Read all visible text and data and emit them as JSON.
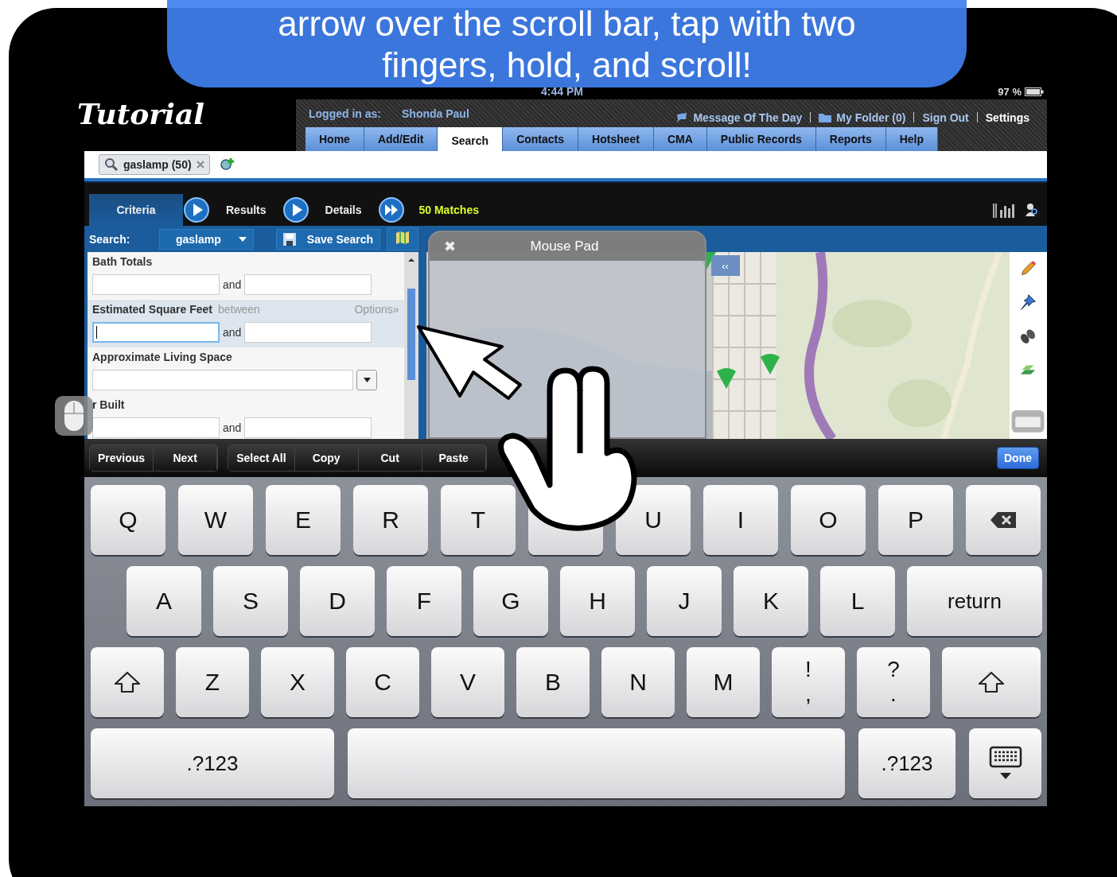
{
  "banner": {
    "lines": [
      "arrow over the scroll bar, tap with two",
      "fingers, hold, and scroll!"
    ]
  },
  "logo": "Tutorial",
  "status_bar": {
    "time": "4:44 PM",
    "battery": "97 %"
  },
  "header": {
    "logged_in_label": "Logged in as:",
    "user": "Shonda Paul",
    "links": [
      {
        "label": "Message Of The Day",
        "kind": "message"
      },
      {
        "label": "My Folder (0)",
        "kind": "folder"
      },
      {
        "label": "Sign Out",
        "kind": "plain"
      },
      {
        "label": "Settings",
        "kind": "plain"
      }
    ],
    "tabs": [
      {
        "label": "Home",
        "selected": false
      },
      {
        "label": "Add/Edit",
        "selected": false
      },
      {
        "label": "Search",
        "selected": true
      },
      {
        "label": "Contacts",
        "selected": false
      },
      {
        "label": "Hotsheet",
        "selected": false
      },
      {
        "label": "CMA",
        "selected": false
      },
      {
        "label": "Public Records",
        "selected": false
      },
      {
        "label": "Reports",
        "selected": false
      },
      {
        "label": "Help",
        "selected": false
      }
    ]
  },
  "search_tab": {
    "label": "gaslamp (50)"
  },
  "nav": {
    "steps": [
      {
        "label": "Criteria",
        "selected": true,
        "kind": "play"
      },
      {
        "label": "Results",
        "selected": false,
        "kind": "play"
      },
      {
        "label": "Details",
        "selected": false,
        "kind": "forward"
      }
    ],
    "matches": "50 Matches"
  },
  "search_bar": {
    "label": "Search:",
    "value": "gaslamp",
    "save": "Save Search"
  },
  "criteria": [
    {
      "label": "Bath Totals",
      "kind": "range",
      "highlighted": false,
      "and": "and"
    },
    {
      "label": "Estimated Square Feet",
      "hint": "between",
      "options": "Options»",
      "kind": "range",
      "highlighted": true,
      "focused": true,
      "and": "and"
    },
    {
      "label": "Approximate Living Space",
      "kind": "select",
      "highlighted": false
    },
    {
      "label": "r Built",
      "kind": "range",
      "highlighted": false,
      "and": "and"
    }
  ],
  "mouse_pad": {
    "title": "Mouse Pad",
    "close": "✖"
  },
  "map": {
    "collapse": "‹‹"
  },
  "toolbar": {
    "groups": [
      [
        "Previous",
        "Next"
      ],
      [
        "Select All",
        "Copy",
        "Cut",
        "Paste"
      ]
    ],
    "done": "Done"
  },
  "keyboard": [
    [
      {
        "kind": "letter",
        "label": "Q"
      },
      {
        "kind": "letter",
        "label": "W"
      },
      {
        "kind": "letter",
        "label": "E"
      },
      {
        "kind": "letter",
        "label": "R"
      },
      {
        "kind": "letter",
        "label": "T"
      },
      {
        "kind": "covered"
      },
      {
        "kind": "letter",
        "label": "U"
      },
      {
        "kind": "letter",
        "label": "I"
      },
      {
        "kind": "letter",
        "label": "O"
      },
      {
        "kind": "letter",
        "label": "P"
      },
      {
        "kind": "backspace"
      }
    ],
    [
      {
        "kind": "letter",
        "label": "A"
      },
      {
        "kind": "letter",
        "label": "S"
      },
      {
        "kind": "letter",
        "label": "D"
      },
      {
        "kind": "letter",
        "label": "F"
      },
      {
        "kind": "letter",
        "label": "G"
      },
      {
        "kind": "letter",
        "label": "H"
      },
      {
        "kind": "letter",
        "label": "J"
      },
      {
        "kind": "letter",
        "label": "K"
      },
      {
        "kind": "letter",
        "label": "L"
      },
      {
        "kind": "word",
        "label": "return"
      }
    ],
    [
      {
        "kind": "shift"
      },
      {
        "kind": "letter",
        "label": "Z"
      },
      {
        "kind": "letter",
        "label": "X"
      },
      {
        "kind": "letter",
        "label": "C"
      },
      {
        "kind": "letter",
        "label": "V"
      },
      {
        "kind": "letter",
        "label": "B"
      },
      {
        "kind": "letter",
        "label": "N"
      },
      {
        "kind": "letter",
        "label": "M"
      },
      {
        "kind": "pair",
        "label": "!",
        "sub": ","
      },
      {
        "kind": "pair",
        "label": "?",
        "sub": "."
      },
      {
        "kind": "shift"
      }
    ],
    [
      {
        "kind": "word",
        "label": ".?123"
      },
      {
        "kind": "space"
      },
      {
        "kind": "word",
        "label": ".?123"
      },
      {
        "kind": "hide"
      }
    ]
  ]
}
